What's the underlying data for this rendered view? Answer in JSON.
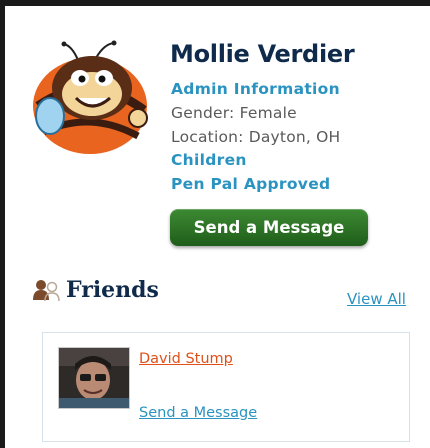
{
  "profile": {
    "name": "Mollie Verdier",
    "details": [
      {
        "text": "Admin Information",
        "kind": "link"
      },
      {
        "text": "Gender: Female",
        "kind": "text"
      },
      {
        "text": "Location: Dayton, OH",
        "kind": "text"
      },
      {
        "text": "Children",
        "kind": "link"
      },
      {
        "text": "Pen Pal Approved",
        "kind": "link"
      }
    ],
    "send_message_label": "Send a Message",
    "avatar_icon": "bee-mascot-icon"
  },
  "friends": {
    "title": "Friends",
    "icon": "friends-icon",
    "view_all_label": "View All",
    "items": [
      {
        "name": "David Stump",
        "send_label": "Send a Message",
        "avatar_icon": "friend-avatar-photo"
      }
    ]
  },
  "colors": {
    "heading": "#0f2a4a",
    "link_blue": "#2a93c0",
    "link_orange": "#e0501a",
    "button_green": "#2e7427",
    "body_text": "#5a5a5a"
  }
}
